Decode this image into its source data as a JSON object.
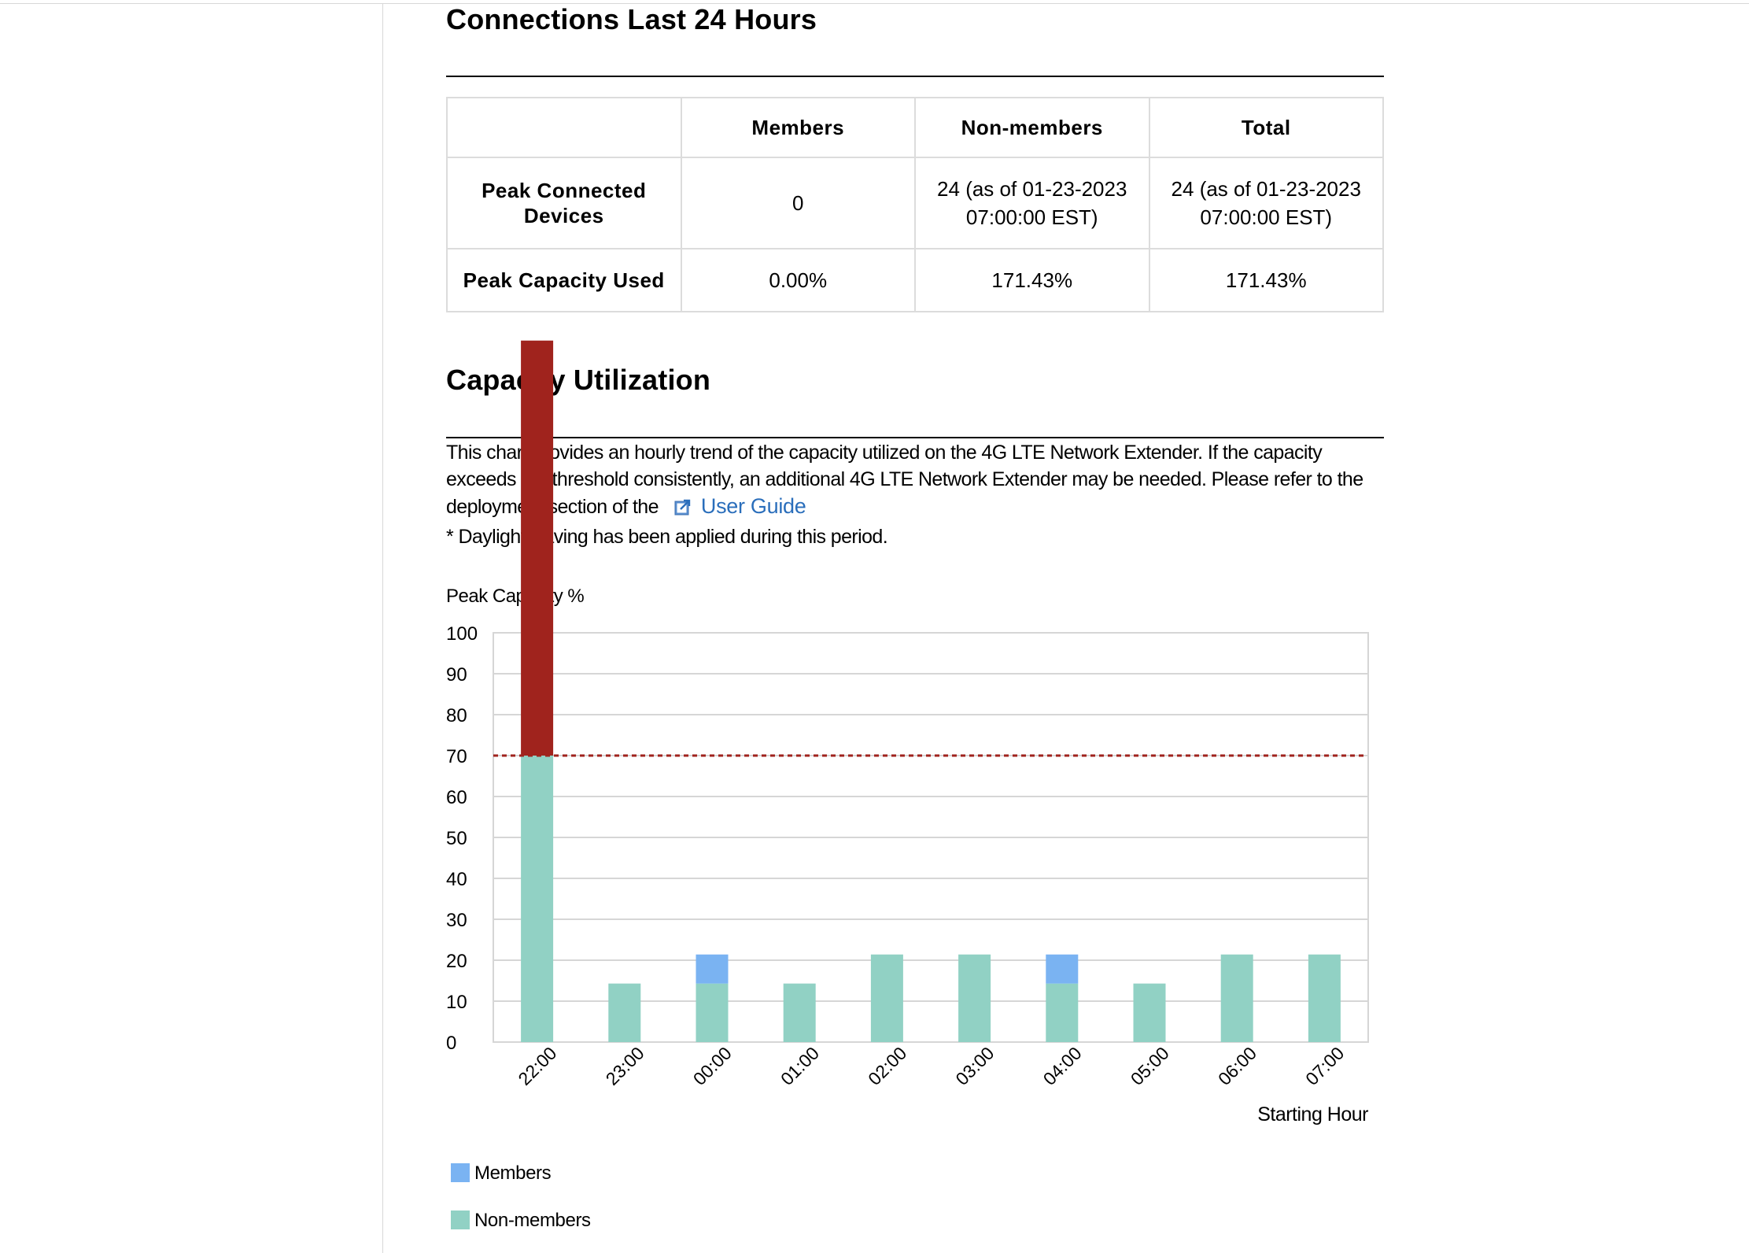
{
  "connections": {
    "title": "Connections Last 24 Hours",
    "columns": [
      "",
      "Members",
      "Non-members",
      "Total"
    ],
    "rows": [
      {
        "label": "Peak Connected Devices",
        "members": "0",
        "nonmembers_line1": "24 (as of 01-23-2023",
        "nonmembers_line2": "07:00:00 EST)",
        "total_line1": "24 (as of 01-23-2023",
        "total_line2": "07:00:00 EST)"
      },
      {
        "label": "Peak Capacity Used",
        "members": "0.00%",
        "nonmembers": "171.43%",
        "total": "171.43%"
      }
    ]
  },
  "capacity": {
    "title": "Capacity Utilization",
    "description": "This chart provides an hourly trend of the capacity utilized on the 4G LTE Network Extender. If the capacity exceeds the threshold consistently, an additional 4G LTE Network Extender may be needed. Please refer to the deployment section of the",
    "link_label": "User Guide",
    "link_icon": "external-link-icon",
    "note": "* Daylight Saving has been applied during this period."
  },
  "chart_data": {
    "type": "bar",
    "stacked": true,
    "ylabel": "Peak Capacity %",
    "xlabel": "Starting Hour",
    "ylim": [
      0,
      100
    ],
    "yticks": [
      0,
      10,
      20,
      30,
      40,
      50,
      60,
      70,
      80,
      90,
      100
    ],
    "grid": true,
    "threshold": 70,
    "categories": [
      "22:00",
      "23:00",
      "00:00",
      "01:00",
      "02:00",
      "03:00",
      "04:00",
      "05:00",
      "06:00",
      "07:00"
    ],
    "series": [
      {
        "name": "Non-members",
        "color": "#91d1c4",
        "values": [
          70,
          14.3,
          14.3,
          14.3,
          21.4,
          21.4,
          14.3,
          14.3,
          21.4,
          21.4
        ]
      },
      {
        "name": "Members",
        "color": "#7ab3f2",
        "values": [
          0,
          0,
          7.1,
          0,
          0,
          0,
          7.1,
          0,
          0,
          0
        ]
      }
    ],
    "over_threshold": {
      "color": "#a0231d",
      "values": [
        101.4,
        0,
        0,
        0,
        0,
        0,
        0,
        0,
        0,
        0
      ]
    },
    "legend": [
      {
        "name": "Members",
        "color": "#7ab3f2"
      },
      {
        "name": "Non-members",
        "color": "#91d1c4"
      }
    ],
    "legend_position": "bottom-left",
    "threshold_color": "#a0231d",
    "grid_color": "#d6d6d6"
  }
}
